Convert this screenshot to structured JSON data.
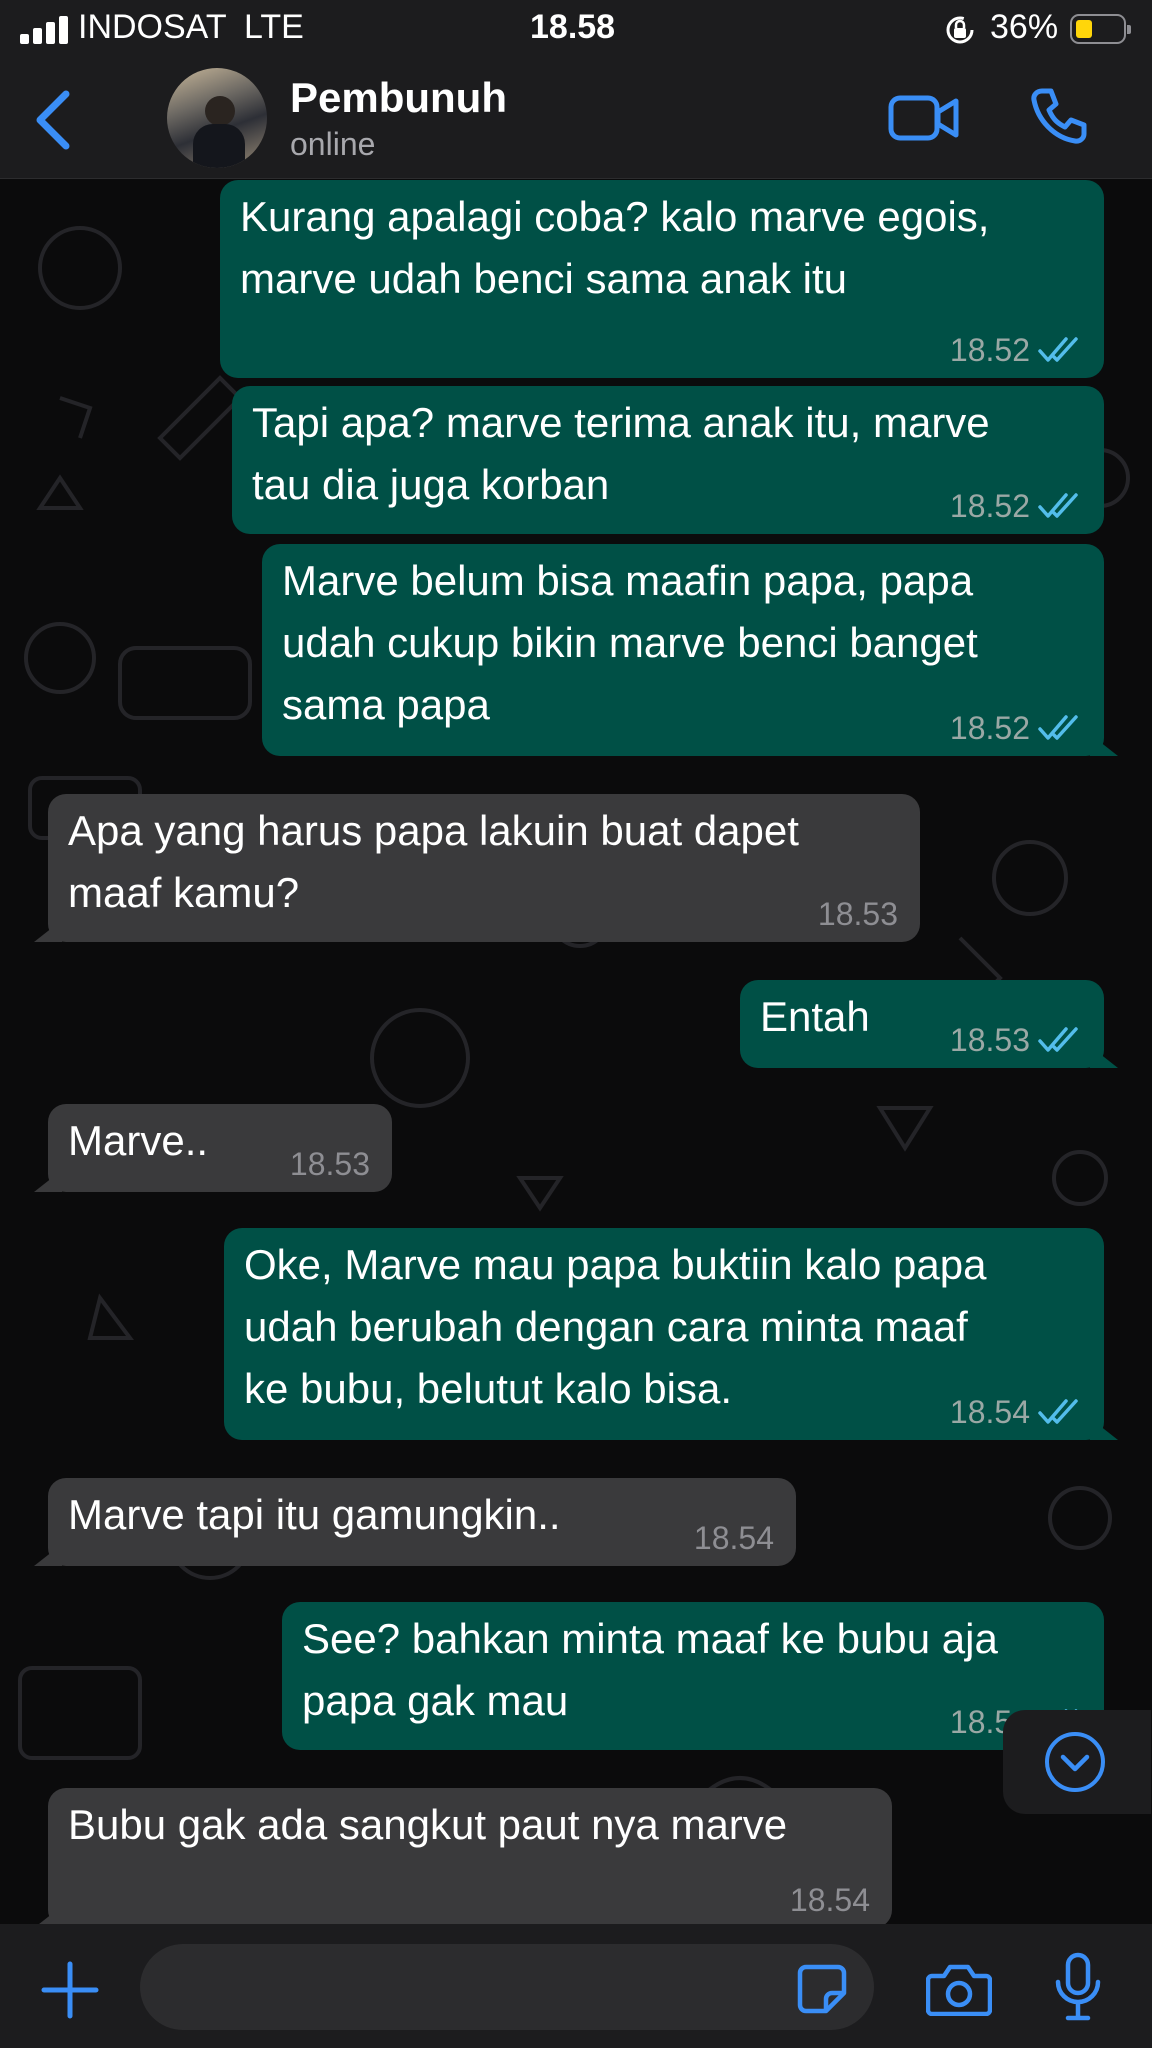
{
  "status_bar": {
    "carrier": "INDOSAT",
    "network": "LTE",
    "time": "18.58",
    "battery_percent": "36%",
    "battery_level": 0.36
  },
  "header": {
    "contact_name": "Pembunuh",
    "presence": "online",
    "icons": [
      "back-icon",
      "video-call-icon",
      "phone-call-icon"
    ]
  },
  "messages": [
    {
      "direction": "outgoing",
      "text": "Kurang apalagi coba? kalo marve egois,\nmarve udah benci sama anak itu",
      "time": "18.52",
      "read": true
    },
    {
      "direction": "outgoing",
      "text": "Tapi apa? marve terima anak itu, marve\ntau dia juga korban",
      "time": "18.52",
      "read": true
    },
    {
      "direction": "outgoing",
      "text": "Marve belum bisa maafin papa, papa\nudah cukup bikin marve benci banget\nsama papa",
      "time": "18.52",
      "read": true
    },
    {
      "direction": "incoming",
      "text": "Apa yang harus papa lakuin buat dapet\nmaaf kamu?",
      "time": "18.53"
    },
    {
      "direction": "outgoing",
      "text": "Entah",
      "time": "18.53",
      "read": true
    },
    {
      "direction": "incoming",
      "text": "Marve..",
      "time": "18.53"
    },
    {
      "direction": "outgoing",
      "text": "Oke, Marve mau papa buktiin kalo papa\nudah berubah dengan cara minta maaf\nke bubu, belutut kalo bisa.",
      "time": "18.54",
      "read": true
    },
    {
      "direction": "incoming",
      "text": "Marve tapi itu gamungkin..",
      "time": "18.54"
    },
    {
      "direction": "outgoing",
      "text": "See? bahkan minta maaf ke bubu aja\npapa gak mau",
      "time": "18.54",
      "read": true
    },
    {
      "direction": "incoming",
      "text": "Bubu gak ada sangkut paut nya marve",
      "time": "18.54"
    }
  ],
  "input_bar": {
    "icons": [
      "plus-icon",
      "sticker-icon",
      "camera-icon",
      "microphone-icon"
    ]
  },
  "colors": {
    "accent": "#3a8ef6",
    "outgoing_bubble": "#005046",
    "incoming_bubble": "#3a3a3c",
    "read_ticks": "#53bdeb",
    "battery": "#ffd60a"
  }
}
